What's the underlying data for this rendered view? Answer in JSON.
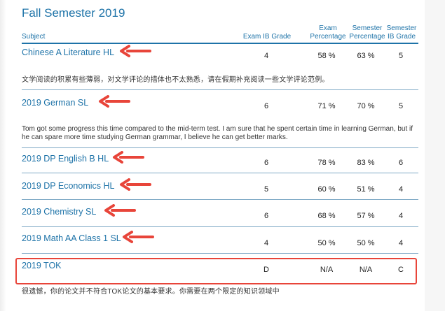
{
  "page": {
    "title": "Fall Semester 2019"
  },
  "headers": {
    "subject": "Subject",
    "exam_ib_grade": "Exam IB Grade",
    "exam_pct_1": "Exam",
    "exam_pct_2": "Percentage",
    "sem_pct_1": "Semester",
    "sem_pct_2": "Percentage",
    "sem_ib_1": "Semester",
    "sem_ib_2": "IB Grade"
  },
  "rows": [
    {
      "subject": "Chinese A Literature HL",
      "exam_ib": "4",
      "exam_pct": "58 %",
      "sem_pct": "63 %",
      "sem_ib": "5",
      "comment": "文学阅读的积累有些薄弱，对文学评论的措体也不太熟悉，请在假期补充阅读一些文学评论范例。"
    },
    {
      "subject": "2019 German SL",
      "exam_ib": "6",
      "exam_pct": "71 %",
      "sem_pct": "70 %",
      "sem_ib": "5",
      "comment_1": "Tom got some progress this time compared to the mid-term test. I am sure that he spent certain time in learning German, but if",
      "comment_2": "he can spare more time studying German grammar, I believe he can get better marks."
    },
    {
      "subject": "2019 DP English B HL",
      "exam_ib": "6",
      "exam_pct": "78 %",
      "sem_pct": "83 %",
      "sem_ib": "6"
    },
    {
      "subject": "2019 DP Economics HL",
      "exam_ib": "5",
      "exam_pct": "60 %",
      "sem_pct": "51 %",
      "sem_ib": "4"
    },
    {
      "subject": "2019 Chemistry SL",
      "exam_ib": "6",
      "exam_pct": "68 %",
      "sem_pct": "57 %",
      "sem_ib": "4"
    },
    {
      "subject": "2019 Math AA Class 1 SL",
      "exam_ib": "4",
      "exam_pct": "50 %",
      "sem_pct": "50 %",
      "sem_ib": "4"
    },
    {
      "subject": "2019 TOK",
      "exam_ib": "D",
      "exam_pct": "N/A",
      "sem_pct": "N/A",
      "sem_ib": "C",
      "comment": "很遗憾，你的论文并不符合TOK论文的基本要求。你需要在两个限定的知识领域中"
    }
  ],
  "colors": {
    "link": "#1e73a8",
    "annotation": "#e8453a"
  }
}
